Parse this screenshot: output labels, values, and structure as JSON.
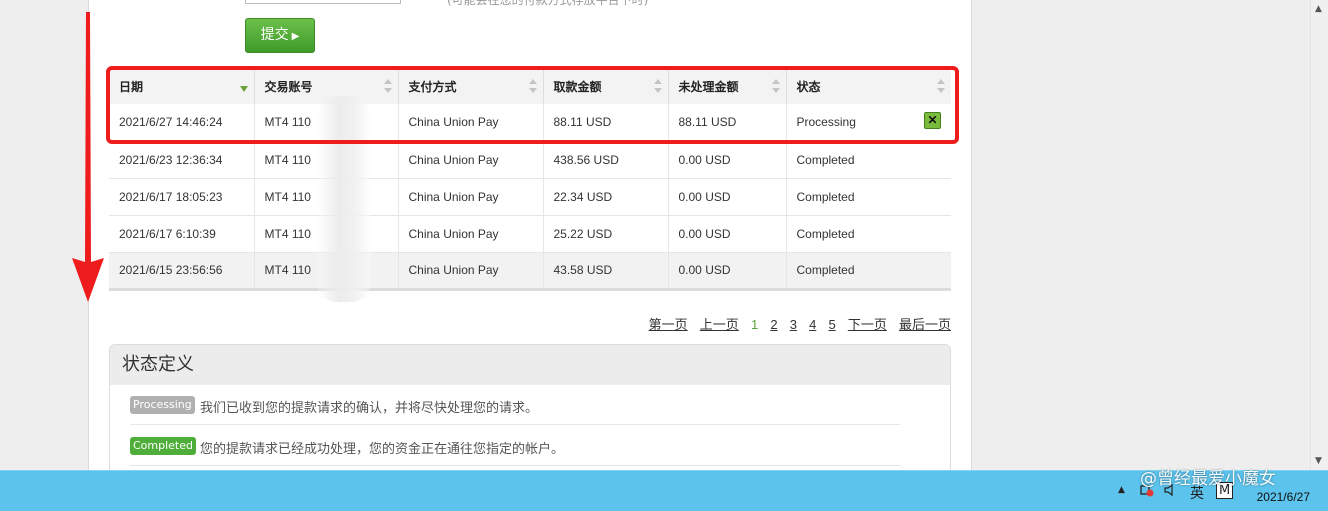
{
  "form": {
    "note": "(可能会在您的付款方式存放平台下时)",
    "submit_label": "提交",
    "submit_arrow": "▶"
  },
  "table": {
    "headers": [
      "日期",
      "交易账号",
      "支付方式",
      "取款金额",
      "未处理金额",
      "状态"
    ],
    "rows": [
      {
        "date": "2021/6/27 14:46:24",
        "account": "MT4 110",
        "method": "China Union Pay",
        "amount": "88.11 USD",
        "pending": "88.11 USD",
        "status": "Processing"
      },
      {
        "date": "2021/6/23 12:36:34",
        "account": "MT4 110",
        "method": "China Union Pay",
        "amount": "438.56 USD",
        "pending": "0.00 USD",
        "status": "Completed"
      },
      {
        "date": "2021/6/17 18:05:23",
        "account": "MT4 110",
        "method": "China Union Pay",
        "amount": "22.34 USD",
        "pending": "0.00 USD",
        "status": "Completed"
      },
      {
        "date": "2021/6/17 6:10:39",
        "account": "MT4 110",
        "method": "China Union Pay",
        "amount": "25.22 USD",
        "pending": "0.00 USD",
        "status": "Completed"
      },
      {
        "date": "2021/6/15 23:56:56",
        "account": "MT4 110",
        "method": "China Union Pay",
        "amount": "43.58 USD",
        "pending": "0.00 USD",
        "status": "Completed"
      }
    ],
    "cancel_symbol": "✕"
  },
  "pagination": {
    "first": "第一页",
    "prev": "上一页",
    "pages": [
      "1",
      "2",
      "3",
      "4",
      "5"
    ],
    "current": "1",
    "next": "下一页",
    "last": "最后一页"
  },
  "status_definitions": {
    "title": "状态定义",
    "items": [
      {
        "badge": "Processing",
        "text": "我们已收到您的提款请求的确认，并将尽快处理您的请求。"
      },
      {
        "badge": "Completed",
        "text": "您的提款请求已经成功处理，您的资金正在通往您指定的帐户。"
      }
    ]
  },
  "taskbar": {
    "watermark": "@曾经最爱小魔女",
    "ime_label": "英",
    "m_label": "M",
    "date": "2021/6/27",
    "up_arrow": "▲"
  },
  "colors": {
    "highlight": "#ee1c1c",
    "accent_green": "#4fae3a",
    "taskbar": "#5bc3ec"
  }
}
